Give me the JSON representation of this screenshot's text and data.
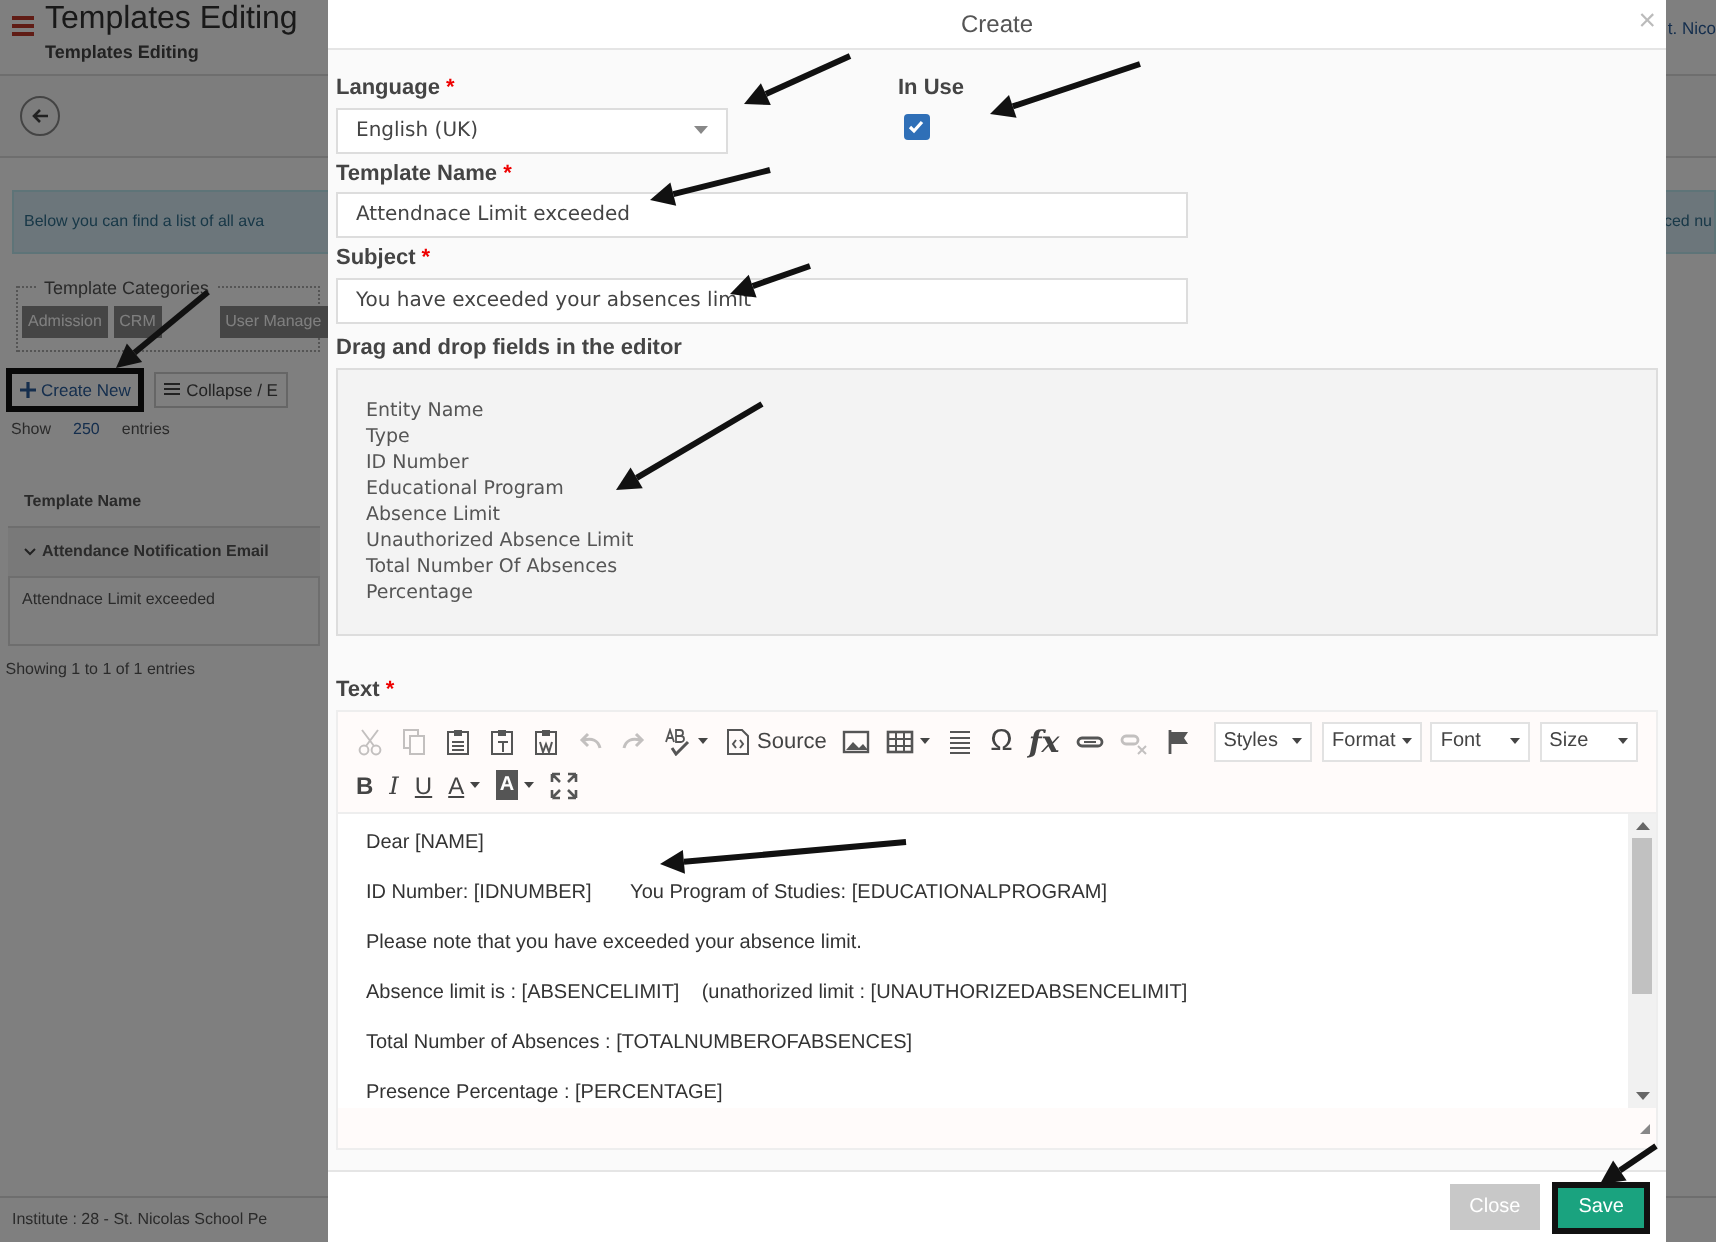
{
  "page": {
    "title": "Templates Editing",
    "subtitle": "Templates Editing",
    "header_right": "t. Nico",
    "info_left": "Below you can find a list of all ava",
    "info_right": "ced nu",
    "categories_legend": "Template Categories",
    "categories": [
      {
        "label": "Admission"
      },
      {
        "label": "CRM"
      },
      {
        "label": "User Manage"
      }
    ],
    "create_button": "Create New",
    "collapse_button": "Collapse / E",
    "show_label": "Show",
    "show_value": "250",
    "entries_label": "entries",
    "table_header": "Template Name",
    "group_row": "Attendance Notification Email",
    "rows": [
      "Attendnace Limit exceeded"
    ],
    "table_info": "Showing 1 to 1 of 1 entries",
    "footer": "Institute : 28 - St. Nicolas School Pe"
  },
  "dialog": {
    "title": "Create",
    "close_glyph": "×",
    "language": {
      "label": "Language",
      "required_mark": "*",
      "value": "English (UK)"
    },
    "in_use": {
      "label": "In Use",
      "checked": true
    },
    "template_name": {
      "label": "Template Name",
      "required_mark": "*",
      "value": "Attendnace Limit exceeded"
    },
    "subject": {
      "label": "Subject",
      "required_mark": "*",
      "value": "You have exceeded your absences limit"
    },
    "fields_label": "Drag and drop fields in the editor",
    "fields": [
      "Entity Name",
      "Type",
      "ID Number",
      "Educational Program",
      "Absence Limit",
      "Unauthorized Absence Limit",
      "Total Number Of Absences",
      "Percentage"
    ],
    "text_label": "Text",
    "text_required_mark": "*",
    "toolbar_row_1": [
      {
        "kind": "icon",
        "disabled": true
      },
      {
        "kind": "icon",
        "disabled": true
      },
      {
        "kind": "icon",
        "disabled": false
      },
      {
        "kind": "icon",
        "disabled": false
      },
      {
        "kind": "icon",
        "disabled": false
      },
      {
        "kind": "icon",
        "disabled": true
      },
      {
        "kind": "icon",
        "disabled": true
      },
      {
        "kind": "icon_menu",
        "disabled": false
      },
      {
        "kind": "labeled",
        "label": "Source",
        "disabled": false
      },
      {
        "kind": "icon",
        "disabled": false
      },
      {
        "kind": "icon_menu",
        "disabled": false
      },
      {
        "kind": "icon",
        "disabled": false
      },
      {
        "kind": "glyph",
        "label": "Ω",
        "disabled": false
      },
      {
        "kind": "glyph_italic",
        "label": "fx",
        "disabled": false
      },
      {
        "kind": "icon",
        "disabled": false
      },
      {
        "kind": "icon",
        "disabled": true
      },
      {
        "kind": "icon",
        "disabled": false
      },
      {
        "kind": "combo",
        "label": "Styles"
      },
      {
        "kind": "combo",
        "label": "Format"
      },
      {
        "kind": "combo",
        "label": "Font"
      },
      {
        "kind": "combo",
        "label": "Size"
      }
    ],
    "toolbar_row_2": [
      {
        "kind": "bold",
        "label": "B"
      },
      {
        "kind": "italic",
        "label": "I"
      },
      {
        "kind": "underline",
        "label": "U"
      },
      {
        "kind": "text_color",
        "label": "A"
      },
      {
        "kind": "bg_color",
        "label": "A"
      },
      {
        "kind": "icon"
      }
    ],
    "content": [
      "Dear [NAME]",
      "ID Number: [IDNUMBER]       You Program of Studies: [EDUCATIONALPROGRAM]",
      "Please note that you have exceeded your absence limit.",
      "Absence limit is : [ABSENCELIMIT]    (unathorized limit : [UNAUTHORIZEDABSENCELIMIT]",
      "Total Number of Absences : [TOTALNUMBEROFABSENCES]",
      "Presence Percentage : [PERCENTAGE]"
    ],
    "buttons": [
      {
        "label": "Close",
        "kind": "secondary",
        "disabled": true
      },
      {
        "label": "Save",
        "kind": "primary",
        "disabled": false
      }
    ]
  }
}
